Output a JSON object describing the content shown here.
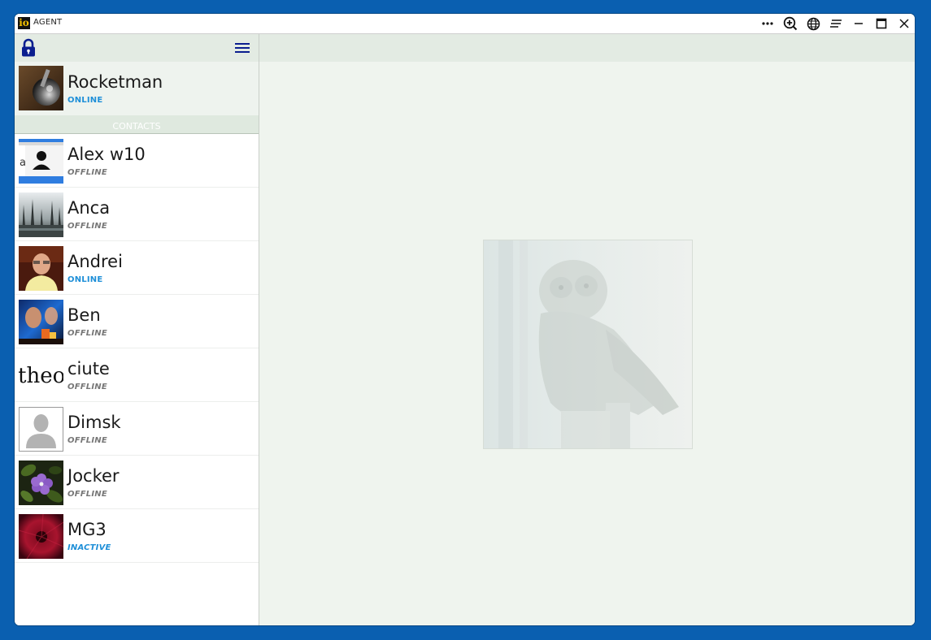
{
  "window": {
    "app_logo": "io",
    "app_title": "AGENT",
    "icons": {
      "more": "more-horizontal-icon",
      "zoom": "zoom-in-icon",
      "globe": "globe-icon",
      "list": "list-icon",
      "minimize": "minimize-icon",
      "maximize": "maximize-icon",
      "close": "close-icon"
    }
  },
  "sidebar": {
    "lock_icon": "lock-icon",
    "menu_icon": "hamburger-menu-icon",
    "self": {
      "name": "Rocketman",
      "status": "ONLINE"
    },
    "contacts_header": "CONTACTS",
    "contacts": [
      {
        "name": "Alex w10",
        "status": "OFFLINE"
      },
      {
        "name": "Anca",
        "status": "OFFLINE"
      },
      {
        "name": "Andrei",
        "status": "ONLINE"
      },
      {
        "name": "Ben",
        "status": "OFFLINE"
      },
      {
        "name": "ciute",
        "status": "OFFLINE",
        "avatar_text": "theo"
      },
      {
        "name": "Dimsk",
        "status": "OFFLINE"
      },
      {
        "name": "Jocker",
        "status": "OFFLINE"
      },
      {
        "name": "MG3",
        "status": "INACTIVE"
      }
    ]
  },
  "colors": {
    "accent_status": "#1e8fd8",
    "offline_status": "#777777",
    "header_bg": "#e3ebe3",
    "main_bg": "#eff4ee",
    "desktop": "#0a5fb0"
  }
}
